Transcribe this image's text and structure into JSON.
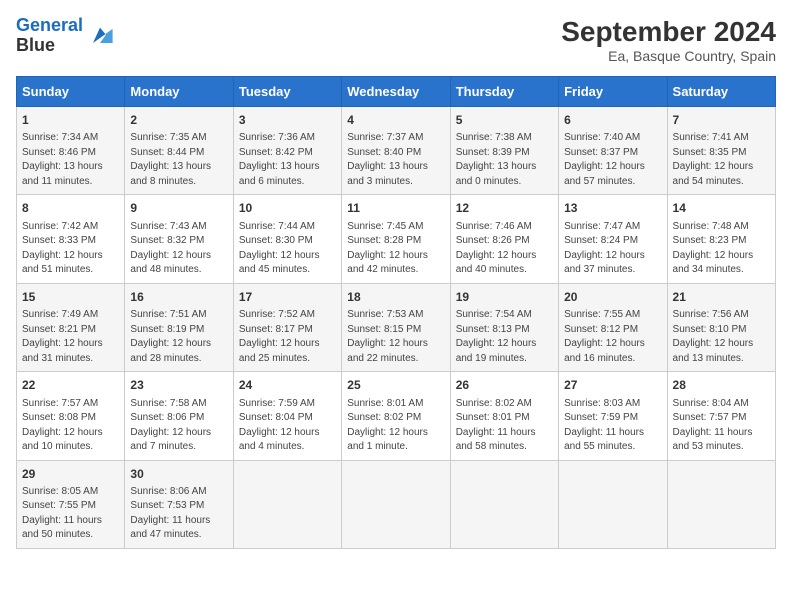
{
  "header": {
    "logo_line1": "General",
    "logo_line2": "Blue",
    "month": "September 2024",
    "location": "Ea, Basque Country, Spain"
  },
  "weekdays": [
    "Sunday",
    "Monday",
    "Tuesday",
    "Wednesday",
    "Thursday",
    "Friday",
    "Saturday"
  ],
  "weeks": [
    [
      {
        "day": "1",
        "info": "Sunrise: 7:34 AM\nSunset: 8:46 PM\nDaylight: 13 hours and 11 minutes."
      },
      {
        "day": "2",
        "info": "Sunrise: 7:35 AM\nSunset: 8:44 PM\nDaylight: 13 hours and 8 minutes."
      },
      {
        "day": "3",
        "info": "Sunrise: 7:36 AM\nSunset: 8:42 PM\nDaylight: 13 hours and 6 minutes."
      },
      {
        "day": "4",
        "info": "Sunrise: 7:37 AM\nSunset: 8:40 PM\nDaylight: 13 hours and 3 minutes."
      },
      {
        "day": "5",
        "info": "Sunrise: 7:38 AM\nSunset: 8:39 PM\nDaylight: 13 hours and 0 minutes."
      },
      {
        "day": "6",
        "info": "Sunrise: 7:40 AM\nSunset: 8:37 PM\nDaylight: 12 hours and 57 minutes."
      },
      {
        "day": "7",
        "info": "Sunrise: 7:41 AM\nSunset: 8:35 PM\nDaylight: 12 hours and 54 minutes."
      }
    ],
    [
      {
        "day": "8",
        "info": "Sunrise: 7:42 AM\nSunset: 8:33 PM\nDaylight: 12 hours and 51 minutes."
      },
      {
        "day": "9",
        "info": "Sunrise: 7:43 AM\nSunset: 8:32 PM\nDaylight: 12 hours and 48 minutes."
      },
      {
        "day": "10",
        "info": "Sunrise: 7:44 AM\nSunset: 8:30 PM\nDaylight: 12 hours and 45 minutes."
      },
      {
        "day": "11",
        "info": "Sunrise: 7:45 AM\nSunset: 8:28 PM\nDaylight: 12 hours and 42 minutes."
      },
      {
        "day": "12",
        "info": "Sunrise: 7:46 AM\nSunset: 8:26 PM\nDaylight: 12 hours and 40 minutes."
      },
      {
        "day": "13",
        "info": "Sunrise: 7:47 AM\nSunset: 8:24 PM\nDaylight: 12 hours and 37 minutes."
      },
      {
        "day": "14",
        "info": "Sunrise: 7:48 AM\nSunset: 8:23 PM\nDaylight: 12 hours and 34 minutes."
      }
    ],
    [
      {
        "day": "15",
        "info": "Sunrise: 7:49 AM\nSunset: 8:21 PM\nDaylight: 12 hours and 31 minutes."
      },
      {
        "day": "16",
        "info": "Sunrise: 7:51 AM\nSunset: 8:19 PM\nDaylight: 12 hours and 28 minutes."
      },
      {
        "day": "17",
        "info": "Sunrise: 7:52 AM\nSunset: 8:17 PM\nDaylight: 12 hours and 25 minutes."
      },
      {
        "day": "18",
        "info": "Sunrise: 7:53 AM\nSunset: 8:15 PM\nDaylight: 12 hours and 22 minutes."
      },
      {
        "day": "19",
        "info": "Sunrise: 7:54 AM\nSunset: 8:13 PM\nDaylight: 12 hours and 19 minutes."
      },
      {
        "day": "20",
        "info": "Sunrise: 7:55 AM\nSunset: 8:12 PM\nDaylight: 12 hours and 16 minutes."
      },
      {
        "day": "21",
        "info": "Sunrise: 7:56 AM\nSunset: 8:10 PM\nDaylight: 12 hours and 13 minutes."
      }
    ],
    [
      {
        "day": "22",
        "info": "Sunrise: 7:57 AM\nSunset: 8:08 PM\nDaylight: 12 hours and 10 minutes."
      },
      {
        "day": "23",
        "info": "Sunrise: 7:58 AM\nSunset: 8:06 PM\nDaylight: 12 hours and 7 minutes."
      },
      {
        "day": "24",
        "info": "Sunrise: 7:59 AM\nSunset: 8:04 PM\nDaylight: 12 hours and 4 minutes."
      },
      {
        "day": "25",
        "info": "Sunrise: 8:01 AM\nSunset: 8:02 PM\nDaylight: 12 hours and 1 minute."
      },
      {
        "day": "26",
        "info": "Sunrise: 8:02 AM\nSunset: 8:01 PM\nDaylight: 11 hours and 58 minutes."
      },
      {
        "day": "27",
        "info": "Sunrise: 8:03 AM\nSunset: 7:59 PM\nDaylight: 11 hours and 55 minutes."
      },
      {
        "day": "28",
        "info": "Sunrise: 8:04 AM\nSunset: 7:57 PM\nDaylight: 11 hours and 53 minutes."
      }
    ],
    [
      {
        "day": "29",
        "info": "Sunrise: 8:05 AM\nSunset: 7:55 PM\nDaylight: 11 hours and 50 minutes."
      },
      {
        "day": "30",
        "info": "Sunrise: 8:06 AM\nSunset: 7:53 PM\nDaylight: 11 hours and 47 minutes."
      },
      null,
      null,
      null,
      null,
      null
    ]
  ]
}
